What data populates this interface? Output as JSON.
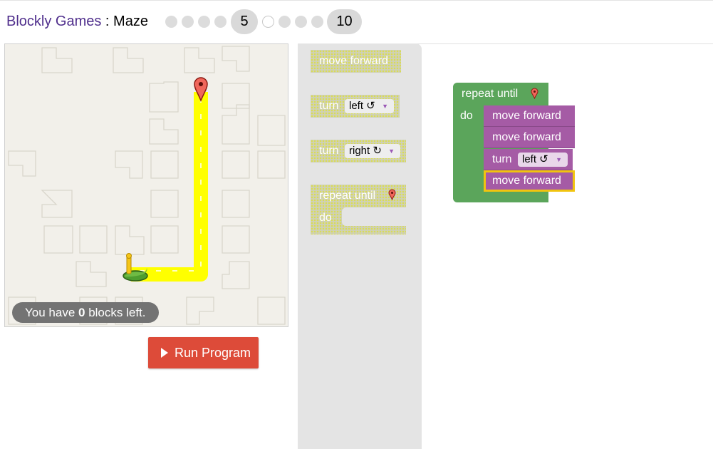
{
  "header": {
    "brand": "Blockly Games",
    "separator": " : ",
    "game": "Maze",
    "current_level": "5",
    "last_level": "10"
  },
  "maze": {
    "capacity_prefix": "You have ",
    "capacity_count": "0",
    "capacity_suffix": " blocks left."
  },
  "run_button": {
    "label": "Run Program"
  },
  "toolbox": {
    "move_forward": "move forward",
    "turn_left": {
      "label": "turn",
      "value": "left ↺"
    },
    "turn_right": {
      "label": "turn",
      "value": "right ↻"
    },
    "repeat_until": {
      "label": "repeat until",
      "do": "do"
    }
  },
  "workspace": {
    "repeat_label": "repeat until",
    "do_label": "do",
    "blocks": [
      {
        "label": "move forward"
      },
      {
        "label": "move forward"
      },
      {
        "label": "turn",
        "value": "left ↺"
      },
      {
        "label": "move forward"
      }
    ]
  },
  "colors": {
    "brand": "#4f2e8c",
    "path": "#ffff00",
    "loop_block": "#5ba55b",
    "action_block": "#a55ba5",
    "run_button": "#dd4b39",
    "selected_outline": "#f1c40f",
    "goal_marker": "#ea4335"
  },
  "icons": {
    "goal": "map-pin-icon",
    "player": "pegman-icon",
    "play": "play-icon"
  }
}
